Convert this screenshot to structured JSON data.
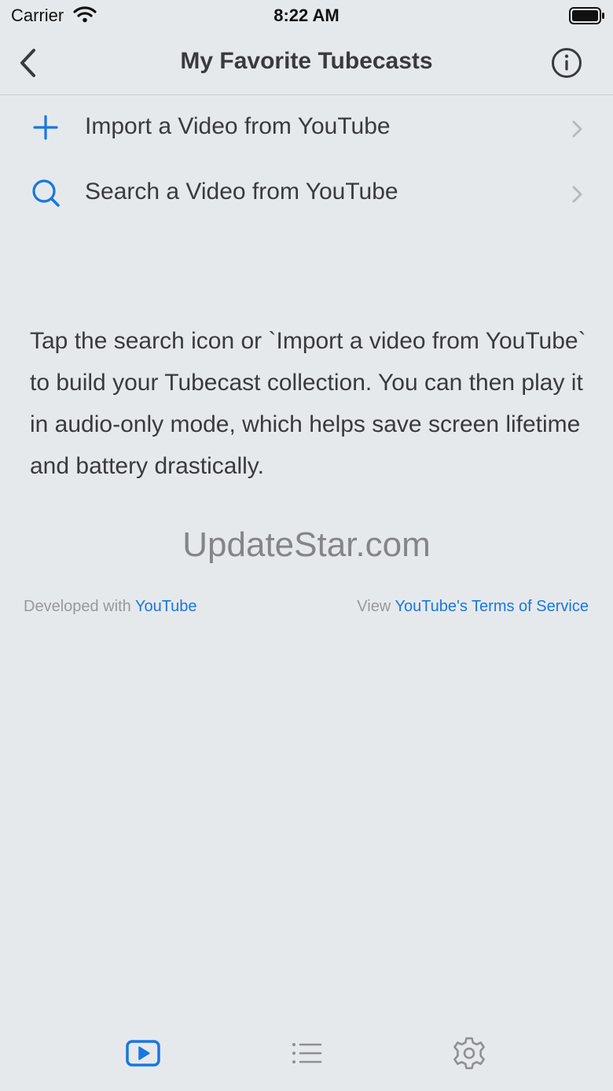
{
  "status_bar": {
    "carrier": "Carrier",
    "time": "8:22 AM",
    "wifi_icon": "wifi-icon",
    "battery_icon": "battery-full-icon"
  },
  "nav": {
    "title": "My Favorite Tubecasts",
    "back_icon": "chevron-left-icon",
    "info_icon": "info-circle-icon"
  },
  "menu": {
    "items": [
      {
        "label": "Import a Video from YouTube",
        "icon": "plus-icon"
      },
      {
        "label": "Search a Video from YouTube",
        "icon": "search-icon"
      }
    ]
  },
  "description": "Tap the search icon or `Import a video from YouTube` to build your Tubecast collection. You can then play it in audio-only mode, which helps save screen lifetime and battery drastically.",
  "watermark": "UpdateStar.com",
  "footer": {
    "developed_prefix": "Developed with ",
    "developed_link": "YouTube",
    "view_prefix": "View ",
    "terms_link": "YouTube's Terms of Service"
  },
  "tab_bar": {
    "tabs": [
      {
        "name": "tubecasts",
        "icon": "play-video-icon",
        "active": true
      },
      {
        "name": "playlist",
        "icon": "list-icon",
        "active": false
      },
      {
        "name": "settings",
        "icon": "gear-icon",
        "active": false
      }
    ]
  },
  "colors": {
    "accent": "#1877e0",
    "background": "#e6e9ec",
    "text": "#3a3a3c",
    "muted": "#98989d",
    "inactive_icon": "#8e8e93"
  }
}
